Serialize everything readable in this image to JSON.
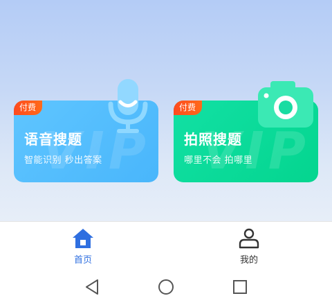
{
  "cards": [
    {
      "id": "voice",
      "badge": "付费",
      "title": "语音搜题",
      "subtitle": "智能识别 秒出答案",
      "watermark": "VIP",
      "icon": "microphone-icon",
      "color": "#49b6fb"
    },
    {
      "id": "photo",
      "badge": "付费",
      "title": "拍照搜题",
      "subtitle": "哪里不会 拍哪里",
      "watermark": "VIP",
      "icon": "camera-icon",
      "color": "#04d58f"
    }
  ],
  "bottom_nav": {
    "items": [
      {
        "label": "首页",
        "icon": "home-icon",
        "active": true
      },
      {
        "label": "我的",
        "icon": "person-icon",
        "active": false
      }
    ],
    "active_color": "#2f6fe0",
    "inactive_color": "#333333"
  },
  "system_nav": {
    "buttons": [
      "back-triangle-icon",
      "home-circle-icon",
      "recent-square-icon"
    ]
  }
}
